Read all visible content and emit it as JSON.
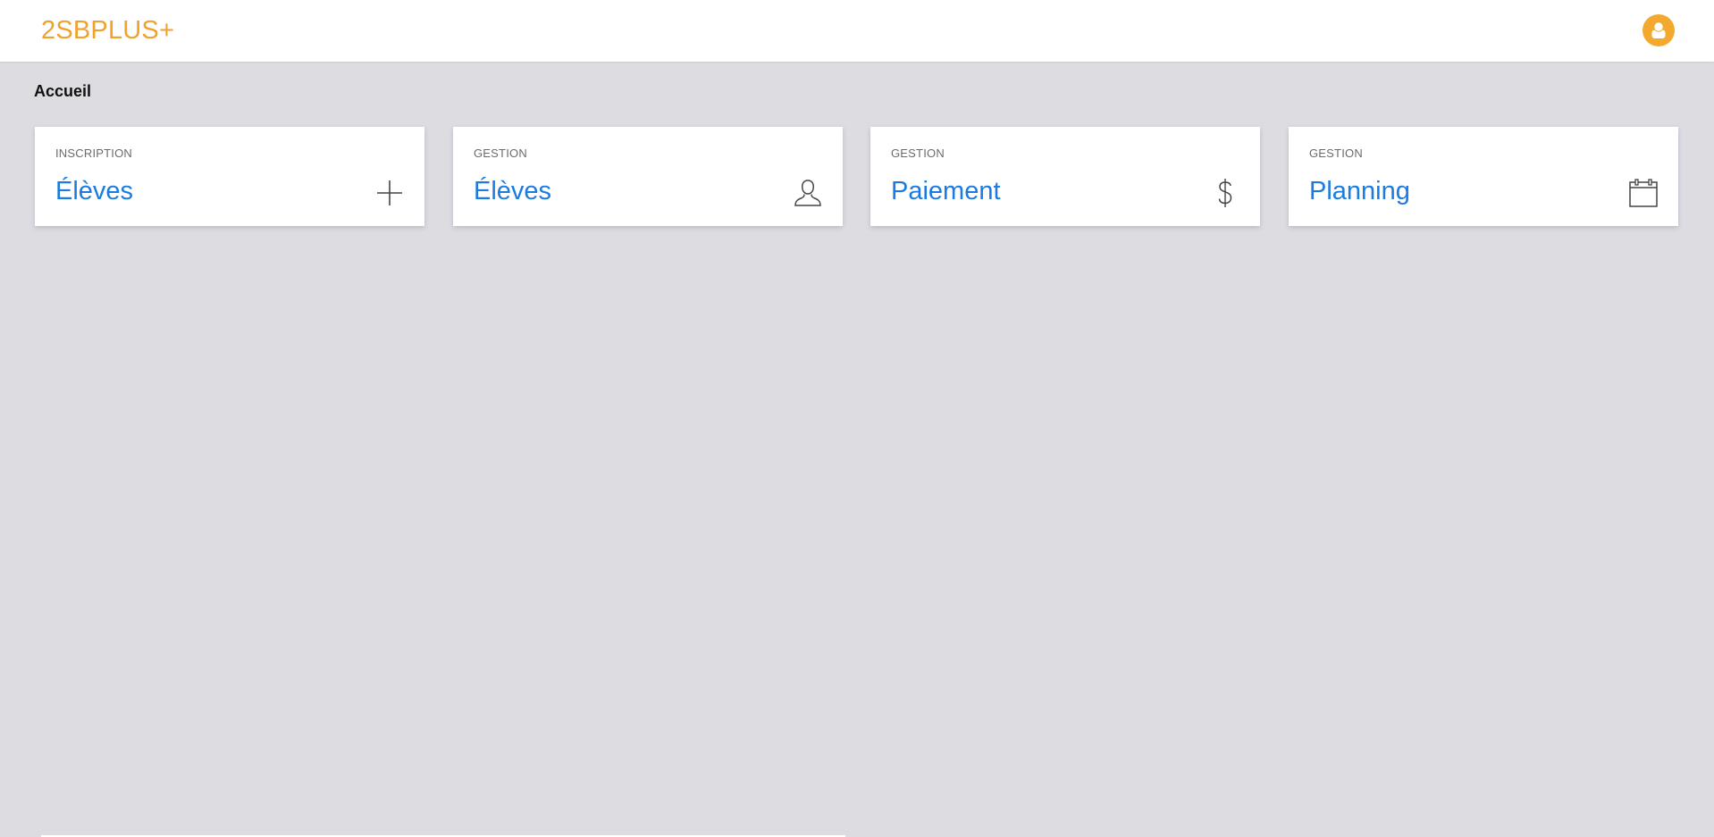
{
  "header": {
    "brand": "2SBPLUS+",
    "brand_color": "#f0a22e",
    "avatar_icon": "user-avatar-icon"
  },
  "breadcrumb": {
    "current": "Accueil"
  },
  "cards": [
    {
      "kicker": "INSCRIPTION",
      "title": "Élèves",
      "icon": "plus-icon"
    },
    {
      "kicker": "GESTION",
      "title": "Élèves",
      "icon": "user-icon"
    },
    {
      "kicker": "GESTION",
      "title": "Paiement",
      "icon": "dollar-icon"
    },
    {
      "kicker": "GESTION",
      "title": "Planning",
      "icon": "calendar-icon"
    }
  ],
  "colors": {
    "accent": "#1a7be0",
    "background": "#dcdce1"
  }
}
